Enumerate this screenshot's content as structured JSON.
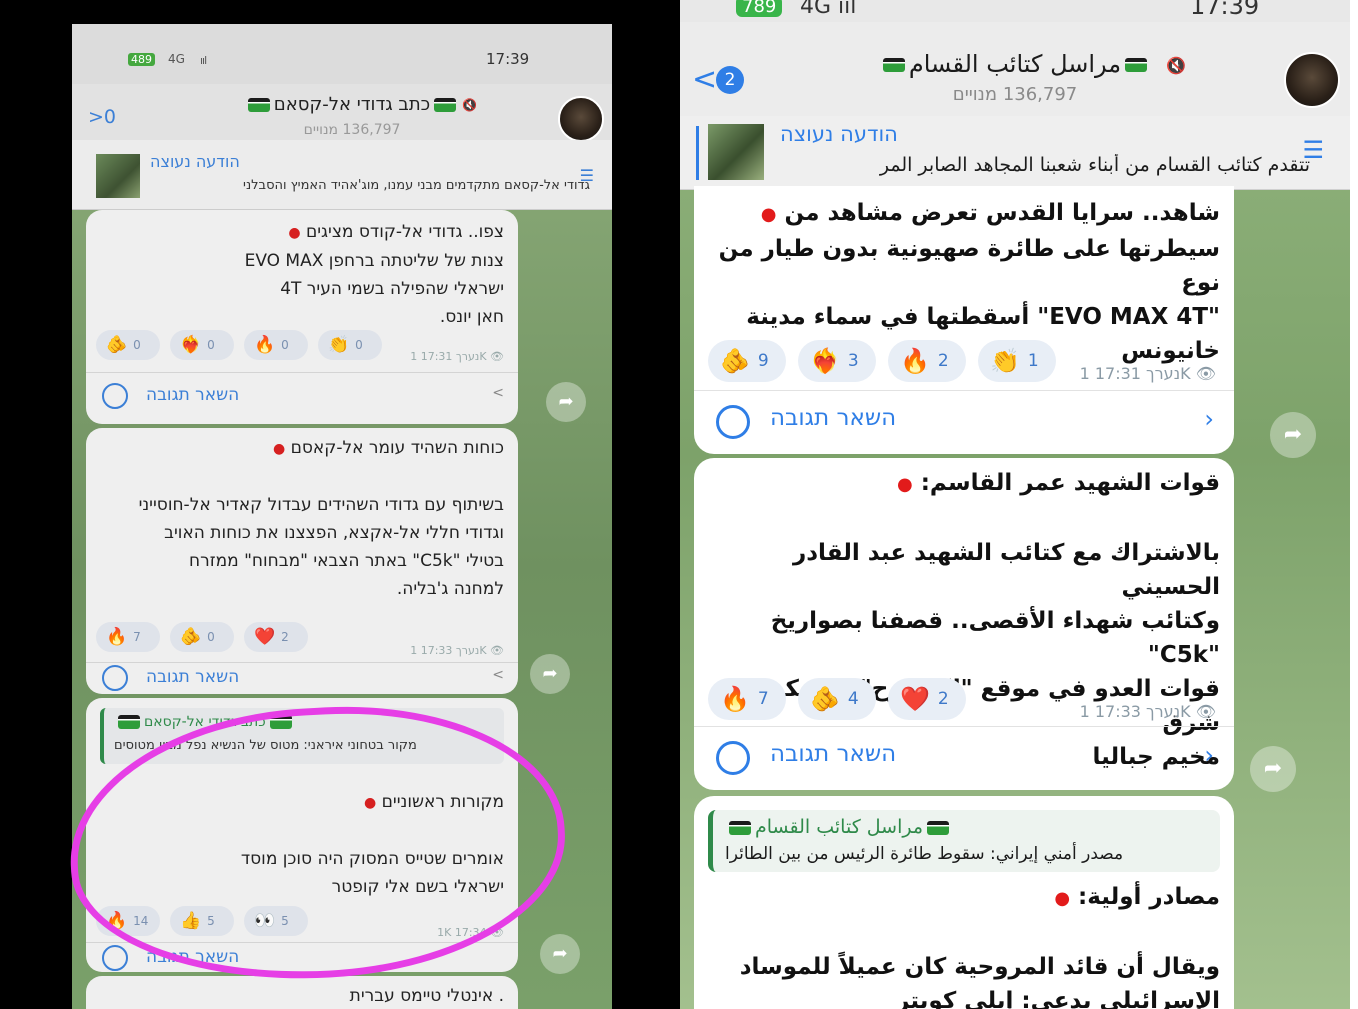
{
  "left": {
    "status": {
      "battery": "489",
      "network": "4G",
      "signal": "ııl",
      "time": "17:39"
    },
    "header": {
      "back": ">0",
      "title": "כתב גדודי אל-קסאם",
      "subscribers": "136,797 מנויים"
    },
    "pinned": {
      "title": "הודעה נעוצה",
      "text": "גדודי אל-קסאם מתקדמים מבני עמנו, מוג'אהיד האמיץ והסבלני"
    },
    "msg1": {
      "lines": [
        "צפו.. גדודי אל-קודס מציגים",
        "צנות של שליטתה ברחפן EVO MAX",
        "ישראלי שהפילה בשמי העיר 4T",
        "חאן יונס."
      ],
      "reactions": [
        {
          "emoji": "🫵",
          "count": "0"
        },
        {
          "emoji": "❤️‍🔥",
          "count": "0"
        },
        {
          "emoji": "🔥",
          "count": "0"
        },
        {
          "emoji": "👏",
          "count": "0"
        }
      ],
      "meta": "נערך 17:31 1K 👁",
      "reply": "השאר תגובה"
    },
    "msg2": {
      "lines": [
        "כוחות השהיד עומר אל-קאסם",
        "",
        "בשיתוף עם גדודי השהידים עבדול קאדיר אל-חוסייני",
        "וגדודי חללי אל-אקצא, הפצצנו את כוחות האויב",
        "בטילי \"C5k\" באתר הצבאי \"מבחוח\" ממזרח",
        "למחנה ג'בליה."
      ],
      "reactions": [
        {
          "emoji": "🔥",
          "count": "7"
        },
        {
          "emoji": "🫵",
          "count": "0"
        },
        {
          "emoji": "❤️",
          "count": "2"
        }
      ],
      "meta": "נערך 17:33 1K 👁",
      "reply": "השאר תגובה"
    },
    "msg3": {
      "quote_name": "כתב גדודי אל-קסאם",
      "quote_text": "מקור בטחוני איראני: מטוס של הנשיא נפל מבין מטוסים",
      "lines": [
        "מקורות ראשוניים",
        "",
        "אומרים שטייס המסוק היה סוכן מוסד",
        "ישראלי בשם אלי קופטר"
      ],
      "reactions": [
        {
          "emoji": "🔥",
          "count": "14"
        },
        {
          "emoji": "👍",
          "count": "5"
        },
        {
          "emoji": "👀",
          "count": "5"
        }
      ],
      "meta": "1K 17:34 👁",
      "reply": "השאר תגובה"
    },
    "msg4": {
      "text": ". אינטלי טיימס עברית"
    }
  },
  "right": {
    "status": {
      "battery": "789",
      "network": "4G ııl",
      "time": "17:39"
    },
    "header": {
      "back": "<",
      "badge": "2",
      "title": "مراسل كتائب القسام",
      "subscribers": "136,797 מנויים"
    },
    "pinned": {
      "title": "הודעה נעוצה",
      "text": "تتقدم كتائب القسام من أبناء شعبنا المجاهد الصابر المر"
    },
    "msg1": {
      "lines": [
        "شاهد.. سرايا القدس تعرض مشاهد من",
        "سيطرتها على طائرة صهيونية بدون طيار من نوع",
        "\"EVO MAX 4T\" أسقطتها في سماء مدينة",
        "خانيونس"
      ],
      "reactions": [
        {
          "emoji": "🫵",
          "count": "9"
        },
        {
          "emoji": "❤️‍🔥",
          "count": "3"
        },
        {
          "emoji": "🔥",
          "count": "2"
        },
        {
          "emoji": "👏",
          "count": "1"
        }
      ],
      "meta": "נערך 17:31 1K 👁",
      "reply": "השאר תגובה"
    },
    "msg2": {
      "lines": [
        "قوات الشهيد عمر القاسم:",
        "",
        "بالاشتراك مع كتائب الشهيد عبد القادر الحسيني",
        "وكتائب شهداء الأقصى.. قصفنا بصواريخ \"C5k\"",
        "قوات العدو في موقع \"المبحوح\" العسكري شرق",
        "مخيم جباليا"
      ],
      "reactions": [
        {
          "emoji": "🔥",
          "count": "7"
        },
        {
          "emoji": "🫵",
          "count": "4"
        },
        {
          "emoji": "❤️",
          "count": "2"
        }
      ],
      "meta": "נערך 17:33 1K 👁",
      "reply": "השאר תגובה"
    },
    "msg3": {
      "quote_name": "مراسل كتائب القسام",
      "quote_text": "مصدر أمني إيراني: سقوط طائرة الرئيس من بين الطائرا",
      "lines": [
        "مصادر أولية:",
        "",
        "ويقال أن قائد المروحية كان عميلاً للموساد",
        "الإسرائيلي يدعى: إيلي كوبتر"
      ]
    }
  },
  "colors": {
    "accent_blue": "#2f7ee6",
    "annotation_magenta": "#e63ee6",
    "red_dot": "#e21b1b"
  }
}
